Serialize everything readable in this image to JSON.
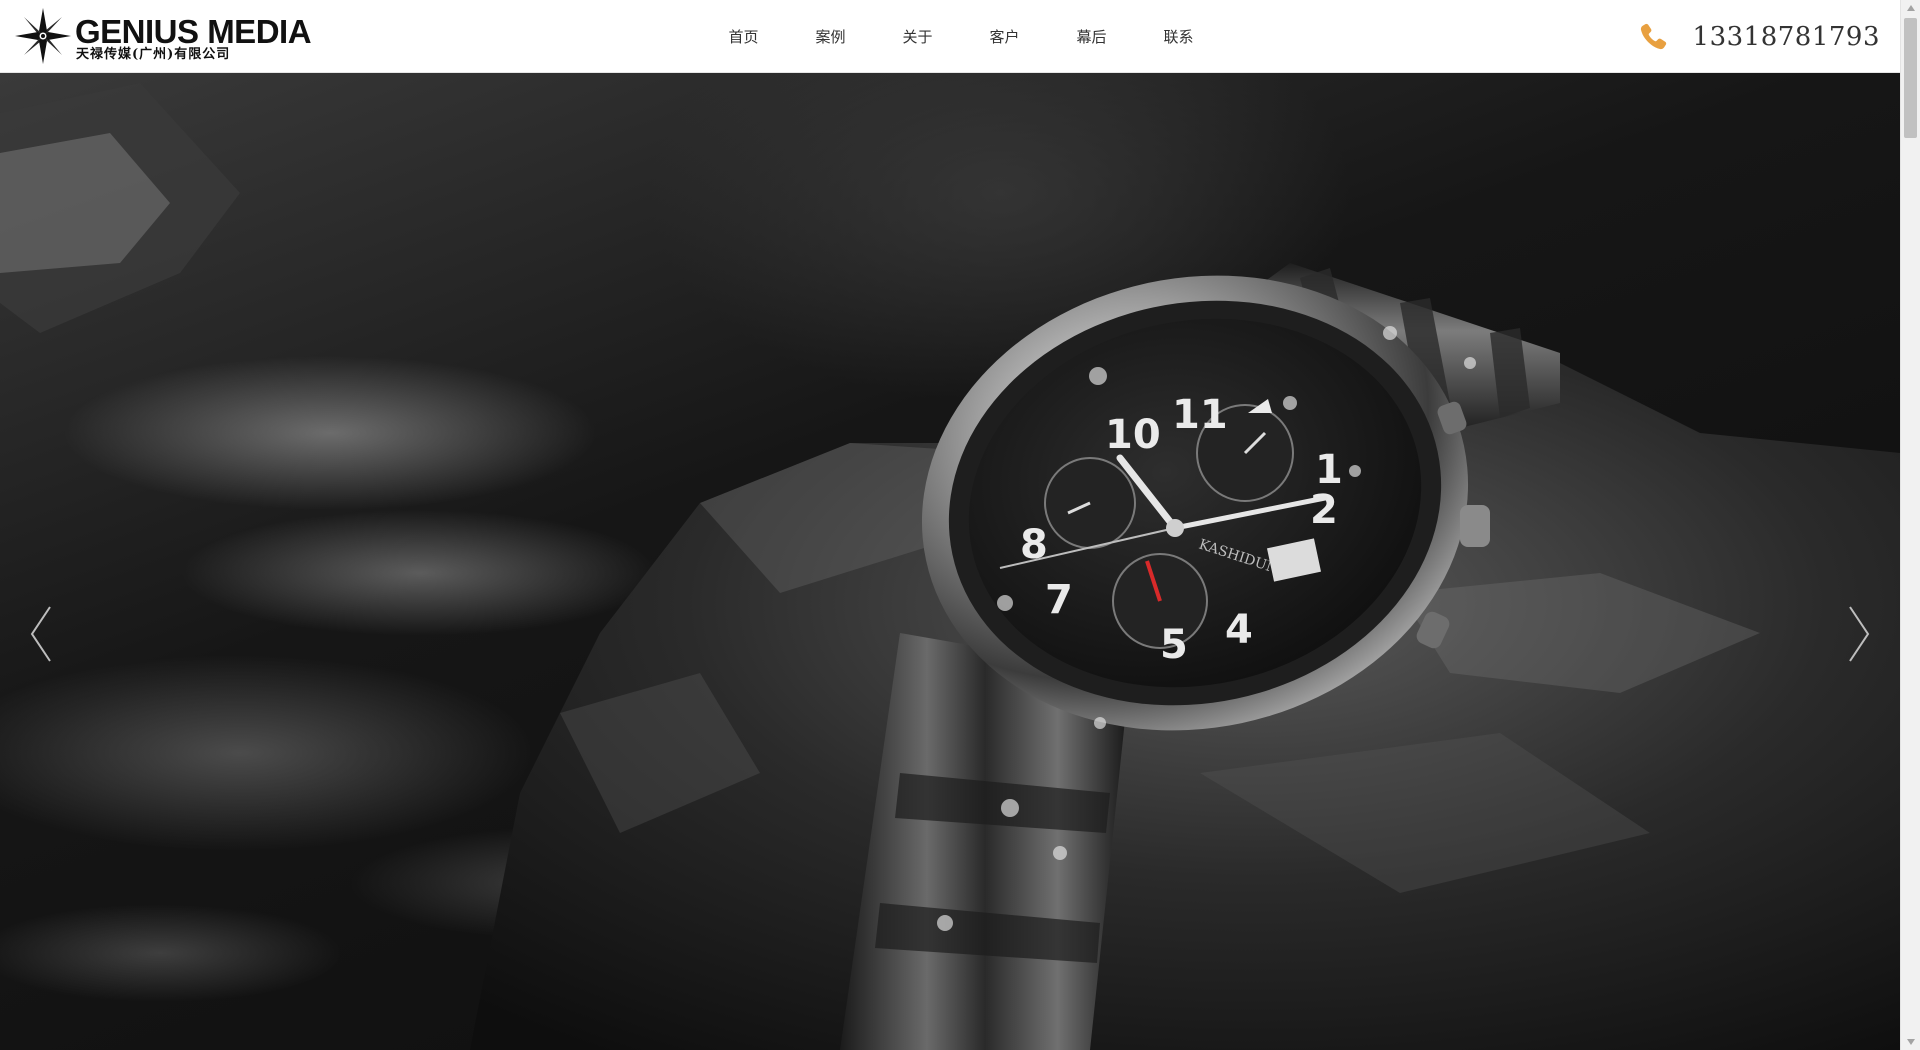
{
  "header": {
    "logo": {
      "title": "GENIUS MEDIA",
      "subtitle": "天禄传媒(广州)有限公司"
    },
    "nav": [
      {
        "label": "首页"
      },
      {
        "label": "案例"
      },
      {
        "label": "关于"
      },
      {
        "label": "客户"
      },
      {
        "label": "幕后"
      },
      {
        "label": "联系"
      }
    ],
    "phone": {
      "icon": "phone-icon",
      "number": "13318781793",
      "icon_color": "#e8a040"
    }
  },
  "banner": {
    "watch_brand": "KASHIDUN",
    "controls": {
      "prev_icon": "chevron-left-icon",
      "next_icon": "chevron-right-icon"
    }
  },
  "colors": {
    "header_bg": "#ffffff",
    "nav_text": "#333333",
    "phone_icon": "#e8a040"
  }
}
